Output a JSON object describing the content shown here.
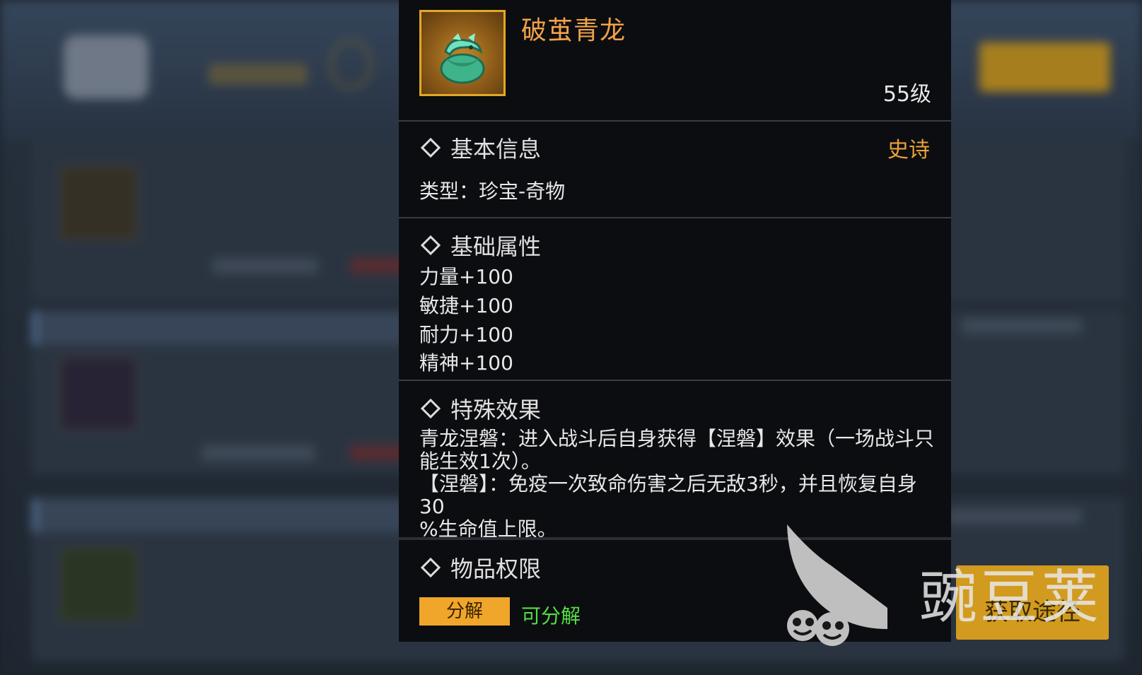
{
  "item": {
    "name": "破茧青龙",
    "level": "55级"
  },
  "basic_info": {
    "title": "基本信息",
    "rarity": "史诗",
    "type_line": "类型：珍宝-奇物"
  },
  "base_attributes": {
    "title": "基础属性",
    "items": [
      "力量+100",
      "敏捷+100",
      "耐力+100",
      "精神+100"
    ]
  },
  "special_effect": {
    "title": "特殊效果",
    "lines": [
      "青龙涅磐：进入战斗后自身获得【涅磐】效果（一场战斗只",
      "能生效1次）。",
      "【涅磐】：免疫一次致命伤害之后无敌3秒，并且恢复自身30",
      "%生命值上限。"
    ]
  },
  "permissions": {
    "title": "物品权限",
    "tag_label": "分解",
    "tag_value": "可分解"
  },
  "background": {
    "get_button_label": "获取途径"
  },
  "watermark": {
    "text": "豌豆荚"
  },
  "colors": {
    "item_name": "#f0a24a",
    "rarity_epic": "#e9a23a",
    "tag_orange": "#f0a62a",
    "decomposable_green": "#53dd46"
  }
}
